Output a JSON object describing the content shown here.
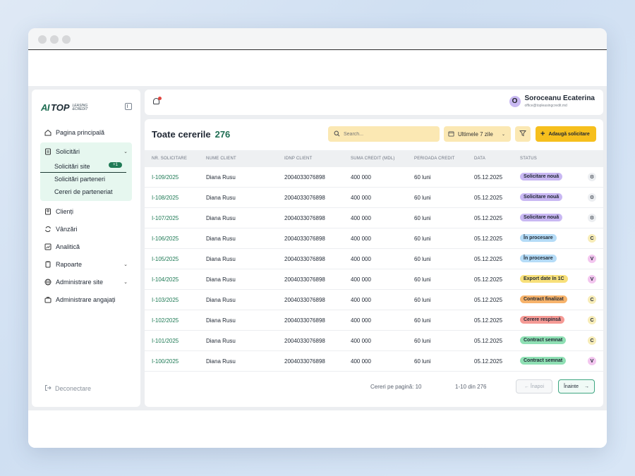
{
  "colors": {
    "brand_green": "#1e6d52",
    "accent_yellow": "#f6bf1d",
    "search_bg": "#fbe8b3",
    "nav_active_bg": "#e6f7ef"
  },
  "brand": {
    "logo_mark": "AI",
    "logo_text": "TOP",
    "logo_sub_1": "LEASING",
    "logo_sub_2": "&CREDIT"
  },
  "sidebar": {
    "items": [
      {
        "label": "Pagina principală",
        "icon": "home-icon"
      },
      {
        "label": "Solicitări",
        "icon": "file-icon"
      },
      {
        "label": "Clienți",
        "icon": "user-icon"
      },
      {
        "label": "Vânzări",
        "icon": "refresh-icon"
      },
      {
        "label": "Analitică",
        "icon": "chart-icon"
      },
      {
        "label": "Rapoarte",
        "icon": "report-icon"
      },
      {
        "label": "Administrare site",
        "icon": "globe-icon"
      },
      {
        "label": "Administrare angajați",
        "icon": "briefcase-icon"
      }
    ],
    "sub_items": [
      {
        "label": "Solicitări site",
        "badge": "+1"
      },
      {
        "label": "Solicitări parteneri"
      },
      {
        "label": "Cereri de parteneriat"
      }
    ],
    "logout_label": "Deconectare"
  },
  "topbar": {
    "user_initial": "O",
    "user_name": "Soroceanu Ecaterina",
    "user_email": "office@topleasingcredit.md"
  },
  "main": {
    "title": "Toate cererile",
    "count": "276",
    "search_placeholder": "Search...",
    "date_filter": "Ultimele 7 zile",
    "add_button": "Adaugă solicitare",
    "columns": [
      "NR. SOLICITARE",
      "NUME CLIENT",
      "IDNP CLIENT",
      "SUMA CREDIT (MDL)",
      "PERIOADA CREDIT",
      "DATA",
      "STATUS"
    ],
    "rows": [
      {
        "id": "I-109/2025",
        "name": "Diana Rusu",
        "idnp": "2004033076898",
        "sum": "400 000",
        "period": "60 luni",
        "date": "05.12.2025",
        "status": "Solicitare nouă",
        "status_color": "#c9b8f3",
        "action": "⚙",
        "action_color": "#eceef1"
      },
      {
        "id": "I-108/2025",
        "name": "Diana Rusu",
        "idnp": "2004033076898",
        "sum": "400 000",
        "period": "60 luni",
        "date": "05.12.2025",
        "status": "Solicitare nouă",
        "status_color": "#c9b8f3",
        "action": "⚙",
        "action_color": "#eceef1"
      },
      {
        "id": "I-107/2025",
        "name": "Diana Rusu",
        "idnp": "2004033076898",
        "sum": "400 000",
        "period": "60 luni",
        "date": "05.12.2025",
        "status": "Solicitare nouă",
        "status_color": "#c9b8f3",
        "action": "⚙",
        "action_color": "#eceef1"
      },
      {
        "id": "I-106/2025",
        "name": "Diana Rusu",
        "idnp": "2004033076898",
        "sum": "400 000",
        "period": "60 luni",
        "date": "05.12.2025",
        "status": "În procesare",
        "status_color": "#b5dcf7",
        "action": "C",
        "action_color": "#f7ecb8"
      },
      {
        "id": "I-105/2025",
        "name": "Diana Rusu",
        "idnp": "2004033076898",
        "sum": "400 000",
        "period": "60 luni",
        "date": "05.12.2025",
        "status": "În procesare",
        "status_color": "#b5dcf7",
        "action": "V",
        "action_color": "#f3c6ef"
      },
      {
        "id": "I-104/2025",
        "name": "Diana Rusu",
        "idnp": "2004033076898",
        "sum": "400 000",
        "period": "60 luni",
        "date": "05.12.2025",
        "status": "Export date în 1C",
        "status_color": "#f8e07a",
        "action": "V",
        "action_color": "#f3c6ef"
      },
      {
        "id": "I-103/2025",
        "name": "Diana Rusu",
        "idnp": "2004033076898",
        "sum": "400 000",
        "period": "60 luni",
        "date": "05.12.2025",
        "status": "Contract finalizat",
        "status_color": "#f7b36b",
        "action": "C",
        "action_color": "#f7ecb8"
      },
      {
        "id": "I-102/2025",
        "name": "Diana Rusu",
        "idnp": "2004033076898",
        "sum": "400 000",
        "period": "60 luni",
        "date": "05.12.2025",
        "status": "Cerere respinsă",
        "status_color": "#f59a95",
        "action": "C",
        "action_color": "#f7ecb8"
      },
      {
        "id": "I-101/2025",
        "name": "Diana Rusu",
        "idnp": "2004033076898",
        "sum": "400 000",
        "period": "60 luni",
        "date": "05.12.2025",
        "status": "Contract semnat",
        "status_color": "#8fe0b4",
        "action": "C",
        "action_color": "#f7ecb8"
      },
      {
        "id": "I-100/2025",
        "name": "Diana Rusu",
        "idnp": "2004033076898",
        "sum": "400 000",
        "period": "60 luni",
        "date": "05.12.2025",
        "status": "Contract semnat",
        "status_color": "#8fe0b4",
        "action": "V",
        "action_color": "#f3c6ef"
      }
    ]
  },
  "pagination": {
    "per_page_label": "Cereri pe pagină: 10",
    "range_label": "1-10 din 276",
    "prev_label": "← Înapoi",
    "next_label": "Înainte",
    "next_arrow": "→"
  }
}
